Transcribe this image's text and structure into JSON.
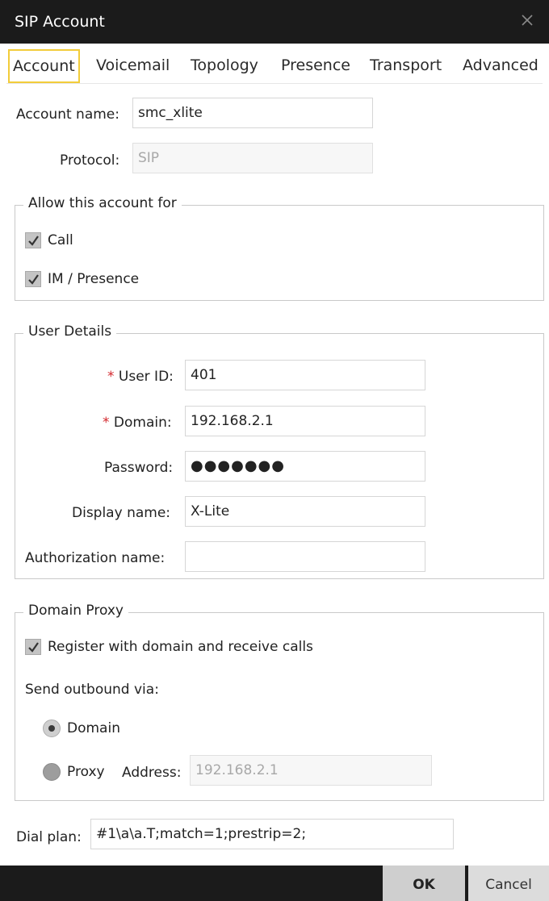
{
  "window": {
    "title": "SIP Account",
    "close_icon": "close-icon"
  },
  "tabs": [
    {
      "label": "Account",
      "active": true
    },
    {
      "label": "Voicemail"
    },
    {
      "label": "Topology"
    },
    {
      "label": "Presence"
    },
    {
      "label": "Transport"
    },
    {
      "label": "Advanced"
    }
  ],
  "account": {
    "name_label": "Account name:",
    "name_value": "smc_xlite",
    "protocol_label": "Protocol:",
    "protocol_value": "SIP"
  },
  "allow": {
    "legend": "Allow this account for",
    "call_label": "Call",
    "call_checked": true,
    "im_label": "IM / Presence",
    "im_checked": true
  },
  "user_details": {
    "legend": "User Details",
    "required_mark": "*",
    "userid_label": "User ID:",
    "userid_value": "401",
    "domain_label": "Domain:",
    "domain_value": "192.168.2.1",
    "password_label": "Password:",
    "password_value": "●●●●●●●",
    "display_label": "Display name:",
    "display_value": "X-Lite",
    "auth_label": "Authorization name:",
    "auth_value": ""
  },
  "domain_proxy": {
    "legend": "Domain Proxy",
    "register_label": "Register with domain and receive calls",
    "register_checked": true,
    "send_label": "Send outbound via:",
    "domain_option": "Domain",
    "proxy_option": "Proxy",
    "selected": "Domain",
    "address_label": "Address:",
    "address_value": "192.168.2.1"
  },
  "dial_plan": {
    "label": "Dial plan:",
    "value": "#1\\a\\a.T;match=1;prestrip=2;"
  },
  "footer": {
    "ok_label": "OK",
    "cancel_label": "Cancel"
  },
  "colors": {
    "titlebar": "#1b1b1b",
    "tab_focus": "#f2cc3a",
    "required": "#d3262b"
  }
}
